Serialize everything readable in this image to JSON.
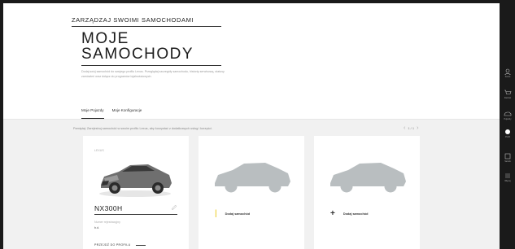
{
  "header": {
    "supertitle": "ZARZĄDZAJ SWOIMI SAMOCHODAMI",
    "title_line1": "MOJE",
    "title_line2": "SAMOCHODY",
    "description": "Dodaj swój samochód do swojego profilu Lexus. Przeglądaj szczegóły samochodu, historię serwisową, statusy zamówień oraz dołącz do programów lojalnościowych."
  },
  "tabs": [
    {
      "label": "Moje Pojazdy",
      "active": true
    },
    {
      "label": "Moje Konfiguracje",
      "active": false
    }
  ],
  "content": {
    "info_line": "Pamiętaj: Zarejestruj samochód w swoim profilu Lexus, aby korzystać z dodatkowych usług i korzyści.",
    "pager_text": "1 / 1"
  },
  "cards": {
    "car": {
      "label": "LEXUS",
      "model": "NX300H",
      "meta_label": "Numer rejestracyjny",
      "meta_value": "b.d.",
      "config_label": "PRZEJDŹ DO PROFILU"
    },
    "add1": {
      "label": "Dodaj samochód"
    },
    "add2": {
      "label": "Dodaj samochód"
    }
  },
  "rail": {
    "items": [
      "Konto",
      "Zamów",
      "Pojazdy",
      "Profil",
      "Serwis",
      "Więcej"
    ]
  },
  "colors": {
    "accent_yellow": "#e8c200",
    "rail_bg": "#1a1a1a",
    "content_bg": "#f1f1f1"
  }
}
